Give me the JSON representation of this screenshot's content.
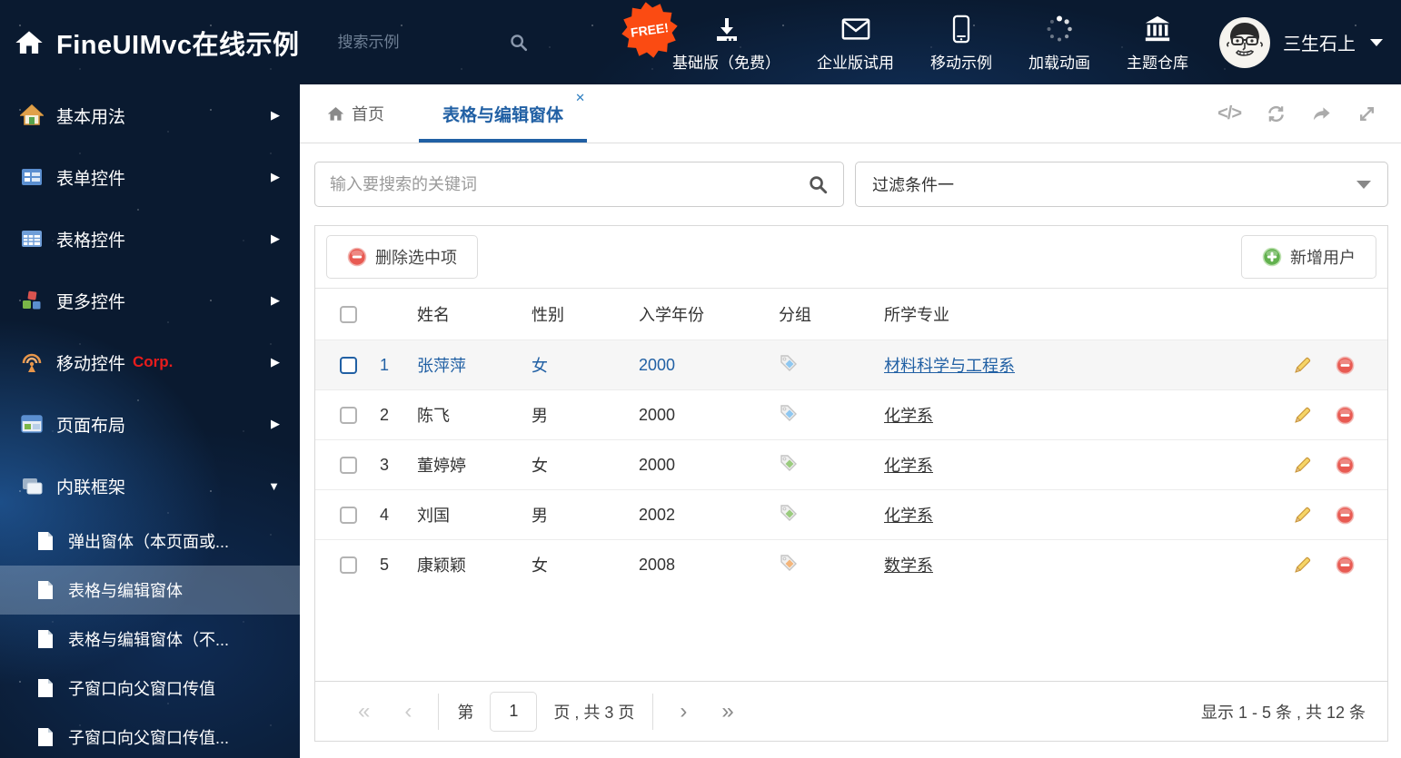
{
  "header": {
    "title": "FineUIMvc在线示例",
    "search_placeholder": "搜索示例",
    "free_badge": "FREE!",
    "nav_items": [
      {
        "label": "基础版（免费）",
        "icon": "download-icon"
      },
      {
        "label": "企业版试用",
        "icon": "envelope-icon"
      },
      {
        "label": "移动示例",
        "icon": "mobile-icon"
      },
      {
        "label": "加载动画",
        "icon": "spinner-icon"
      },
      {
        "label": "主题仓库",
        "icon": "bank-icon"
      }
    ],
    "user_name": "三生石上"
  },
  "sidebar": {
    "items": [
      {
        "label": "基本用法",
        "icon": "house-icon"
      },
      {
        "label": "表单控件",
        "icon": "form-icon"
      },
      {
        "label": "表格控件",
        "icon": "table-icon"
      },
      {
        "label": "更多控件",
        "icon": "cubes-icon"
      },
      {
        "label": "移动控件",
        "suffix": "Corp.",
        "icon": "antenna-icon"
      },
      {
        "label": "页面布局",
        "icon": "layout-icon"
      },
      {
        "label": "内联框架",
        "icon": "frames-icon"
      }
    ],
    "subitems": [
      {
        "label": "弹出窗体（本页面或..."
      },
      {
        "label": "表格与编辑窗体"
      },
      {
        "label": "表格与编辑窗体（不..."
      },
      {
        "label": "子窗口向父窗口传值"
      },
      {
        "label": "子窗口向父窗口传值..."
      }
    ]
  },
  "tabs": {
    "home": "首页",
    "active": "表格与编辑窗体"
  },
  "filter": {
    "search_placeholder": "输入要搜索的关键词",
    "dropdown_value": "过滤条件一"
  },
  "toolbar": {
    "delete_label": "删除选中项",
    "add_label": "新增用户"
  },
  "table": {
    "headers": [
      "姓名",
      "性别",
      "入学年份",
      "分组",
      "所学专业"
    ],
    "rows": [
      {
        "num": "1",
        "name": "张萍萍",
        "gender": "女",
        "year": "2000",
        "tag_color": "#8ec7f1",
        "major": "材料科学与工程系",
        "selected": true
      },
      {
        "num": "2",
        "name": "陈飞",
        "gender": "男",
        "year": "2000",
        "tag_color": "#8ec7f1",
        "major": "化学系",
        "selected": false
      },
      {
        "num": "3",
        "name": "董婷婷",
        "gender": "女",
        "year": "2000",
        "tag_color": "#9acb7e",
        "major": "化学系",
        "selected": false
      },
      {
        "num": "4",
        "name": "刘国",
        "gender": "男",
        "year": "2002",
        "tag_color": "#9acb7e",
        "major": "化学系",
        "selected": false
      },
      {
        "num": "5",
        "name": "康颖颖",
        "gender": "女",
        "year": "2008",
        "tag_color": "#f4b57a",
        "major": "数学系",
        "selected": false
      }
    ]
  },
  "pagination": {
    "page_prefix": "第",
    "page": "1",
    "page_suffix": "页 , 共 3 页",
    "summary": "显示 1 - 5 条 , 共 12 条"
  },
  "colors": {
    "accent": "#2160a4",
    "free_badge_bg": "#fb4b12",
    "selected_row_bg": "#f6f6f6",
    "corp_red": "#e81c1c"
  }
}
